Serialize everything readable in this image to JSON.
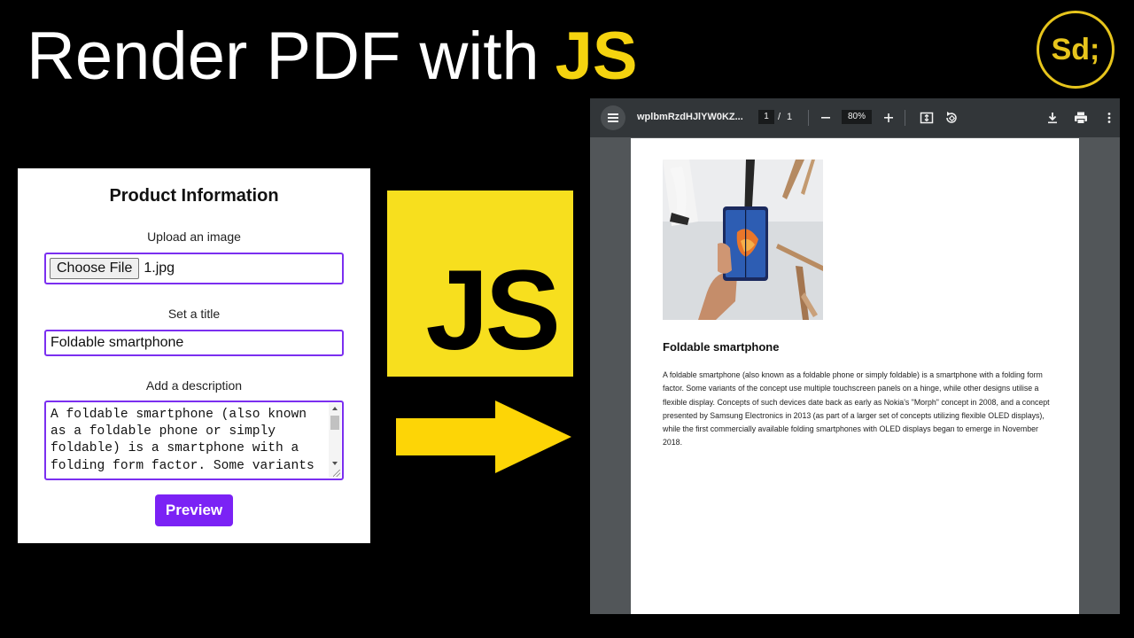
{
  "headline": {
    "text": "Render PDF with",
    "accent": "JS"
  },
  "logo": {
    "text": "Sd;"
  },
  "form": {
    "title": "Product Information",
    "upload_label": "Upload an image",
    "choose_file": "Choose File",
    "file_name": "1.jpg",
    "title_label": "Set a title",
    "title_value": "Foldable smartphone",
    "description_label": "Add a description",
    "description_value": "A foldable smartphone (also known\nas a foldable phone or simply\nfoldable) is a smartphone with a\nfolding form factor. Some variants",
    "preview_button": "Preview"
  },
  "js_logo": {
    "text": "JS",
    "color": "#f7df1e"
  },
  "arrow": {
    "color": "#fdd506"
  },
  "pdf_viewer": {
    "file_name": "wplbmRzdHJlYW0KZ...",
    "current_page": "1",
    "page_separator": "/",
    "total_pages": "1",
    "zoom": "80%",
    "icons": [
      "menu-icon",
      "zoom-out-icon",
      "zoom-in-icon",
      "fit-page-icon",
      "rotate-icon",
      "download-icon",
      "print-icon",
      "more-icon"
    ],
    "document": {
      "title": "Foldable smartphone",
      "body": "A foldable smartphone (also known as a foldable phone or simply foldable) is a smartphone with a folding form factor. Some variants of the concept use multiple touchscreen panels on a hinge, while other designs utilise a flexible display. Concepts of such devices date back as early as Nokia's \"Morph\" concept in 2008, and a concept presented by Samsung Electronics in 2013 (as part of a larger set of concepts utilizing flexible OLED displays), while the first commercially available folding smartphones with OLED displays began to emerge in November 2018."
    }
  }
}
